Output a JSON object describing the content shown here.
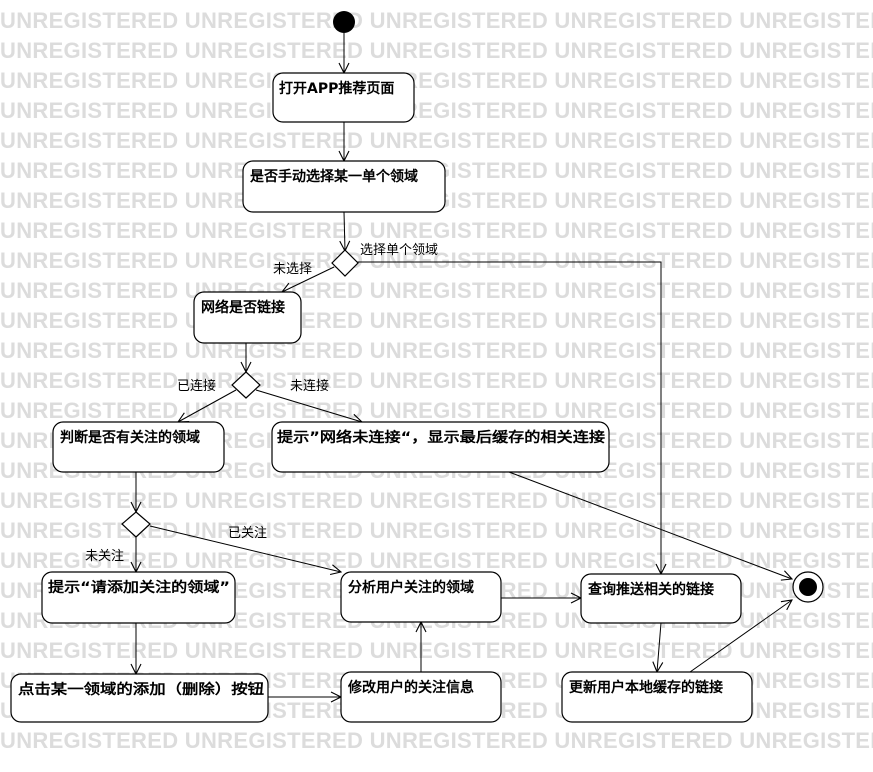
{
  "watermark": {
    "text": "UNREGISTERED UNREGISTERED UNREGISTERED UNREGISTERED UNREGISTERED"
  },
  "nodes": {
    "open_app": "打开APP推荐页面",
    "manual_select": "是否手动选择某一单个领域",
    "network": "网络是否链接",
    "judge_followed": "判断是否有关注的领域",
    "prompt_offline": "提示”网络未连接“，显示最后缓存的相关连接",
    "prompt_add": "提示“请添加关注的领域”",
    "analyze": "分析用户关注的领域",
    "query": "查询推送相关的链接",
    "click_add": "点击某一领域的添加（删除）按钮",
    "modify": "修改用户的关注信息",
    "update_cache": "更新用户本地缓存的链接"
  },
  "edges": {
    "single_selected": "选择单个领域",
    "not_selected": "未选择",
    "connected": "已连接",
    "not_connected": "未连接",
    "followed": "已关注",
    "not_followed": "未关注"
  }
}
